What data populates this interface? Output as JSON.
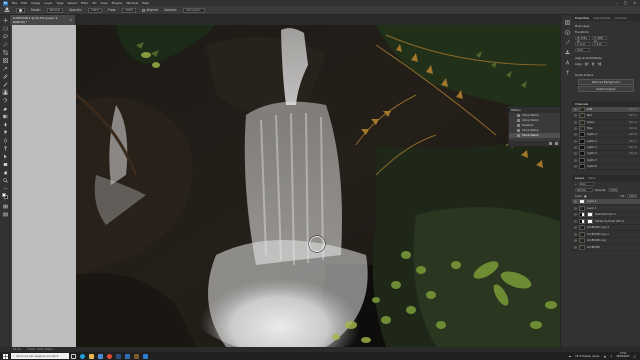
{
  "menubar": {
    "logo": "Ps",
    "items": [
      "File",
      "Edit",
      "Image",
      "Layer",
      "Type",
      "Select",
      "Filter",
      "3D",
      "View",
      "Plugins",
      "Window",
      "Help"
    ]
  },
  "optionsbar": {
    "mode_label": "Mode:",
    "mode_value": "Normal",
    "opacity_label": "Opacity:",
    "opacity_value": "100%",
    "flow_label": "Flow:",
    "flow_value": "100%",
    "aligned_label": "Aligned",
    "sample_label": "Sample:",
    "sample_value": "All Layers"
  },
  "document_tab": {
    "title": "LU1E0348-1 @ 61,2% (Layer 2, RGB/16) *"
  },
  "history": {
    "title": "History",
    "items": [
      "Clone Stamp",
      "Clone Stamp",
      "Deselect",
      "Clone Stamp",
      "Clone Stamp"
    ],
    "selected_index": 4
  },
  "properties": {
    "tabs": [
      "Properties",
      "Adjustments",
      "Libraries"
    ],
    "layer_type": "Pixel Layer",
    "transform_label": "Transform",
    "w_value": "W: 4361 px",
    "h_value": "H: 2907 px",
    "x_value": "X: 0 px",
    "y_value": "Y: 0 px",
    "angle_value": "0,00°",
    "align_label": "Align and Distribute",
    "align_sub": "Align:",
    "quick_actions_label": "Quick Actions",
    "remove_bg": "Remove Background",
    "select_subject": "Select Subject"
  },
  "channels": {
    "tabs": [
      "Channels"
    ],
    "items": [
      {
        "name": "RGB",
        "shortcut": "Ctrl+2"
      },
      {
        "name": "Red",
        "shortcut": "Ctrl+3"
      },
      {
        "name": "Green",
        "shortcut": "Ctrl+4"
      },
      {
        "name": "Blue",
        "shortcut": "Ctrl+5"
      },
      {
        "name": "Lights 1",
        "shortcut": "Ctrl+6"
      },
      {
        "name": "Lights 2",
        "shortcut": "Ctrl+7"
      },
      {
        "name": "Lights 3",
        "shortcut": "Ctrl+8"
      },
      {
        "name": "Lights 4",
        "shortcut": "Ctrl+9"
      },
      {
        "name": "Lights 5",
        "shortcut": ""
      },
      {
        "name": "Lights 6",
        "shortcut": ""
      }
    ]
  },
  "layers": {
    "tabs": [
      "Layers",
      "Paths"
    ],
    "kind_label": "Kind",
    "blend_mode": "Normal",
    "opacity_label": "Opacity:",
    "opacity_value": "100%",
    "lock_label": "Lock:",
    "fill_label": "Fill:",
    "fill_value": "100%",
    "items": [
      {
        "name": "Layer 2",
        "thumb": "white",
        "mask": false
      },
      {
        "name": "Layer 1",
        "thumb": "photo",
        "mask": false
      },
      {
        "name": "Selective Color 1",
        "thumb": "adj",
        "mask": true
      },
      {
        "name": "Hidden Summer (DP 1)",
        "thumb": "adj",
        "mask": true
      },
      {
        "name": "LU1E0348 copy 3",
        "thumb": "photo",
        "mask": false
      },
      {
        "name": "LU1E0348 copy 2",
        "thumb": "photo",
        "mask": false
      },
      {
        "name": "LU1E0348 copy",
        "thumb": "photo",
        "mask": false
      },
      {
        "name": "LU1E0348",
        "thumb": "photo",
        "mask": false
      }
    ],
    "selected_index": 0
  },
  "statusbar": {
    "zoom": "61,2%",
    "info": "Profilo: RGB (16bpc)"
  },
  "taskbar": {
    "search_placeholder": "Scrivi qui per eseguire la ricerca",
    "weather": "19°C Preval. nuvol.",
    "time": "17:54",
    "date": "18/09/2023"
  },
  "colors": {
    "accent": "#2d6fb0",
    "chrome_dark": "#323232",
    "foreground_swatch": "#ffffff",
    "background_swatch": "#000000"
  }
}
